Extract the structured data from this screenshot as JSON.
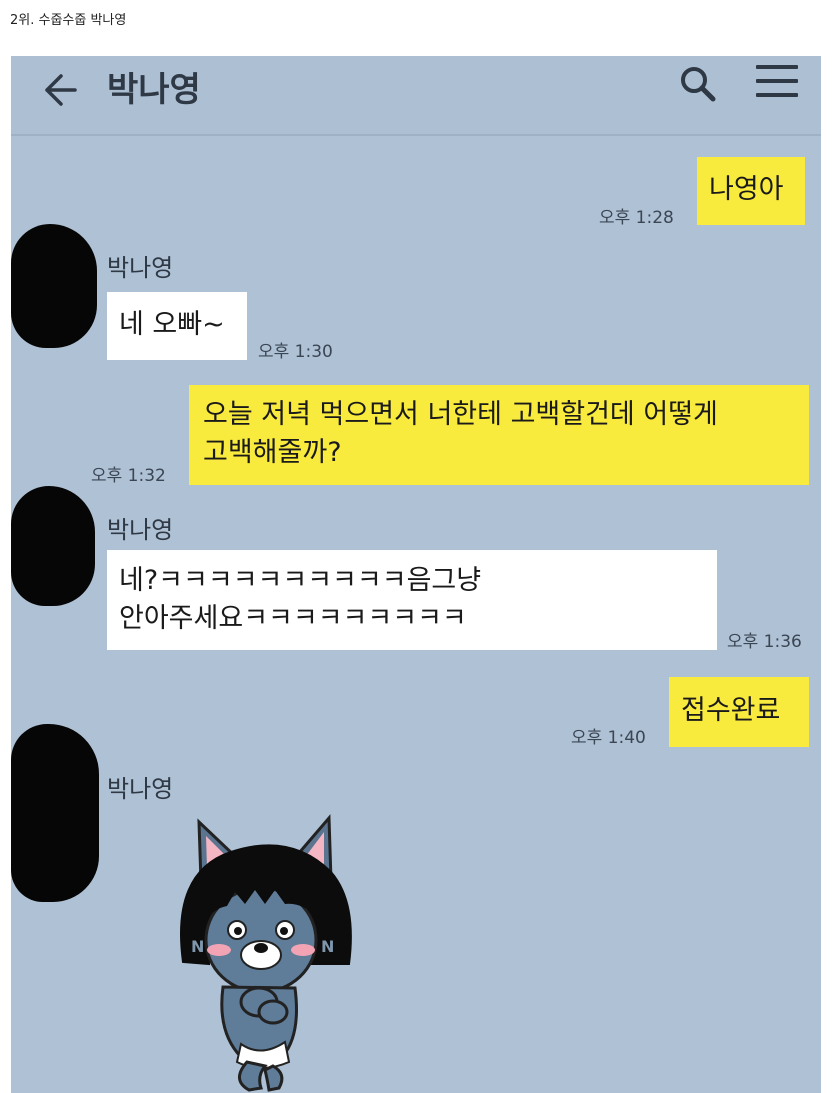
{
  "caption": "2위. 수줍수줍 박나영",
  "chat": {
    "title": "박나영",
    "icons": {
      "back": "back-arrow-icon",
      "search": "search-icon",
      "menu": "hamburger-menu-icon"
    },
    "messages": [
      {
        "from": "me",
        "text": "나영아",
        "time": "오후 1:28"
      },
      {
        "from": "them",
        "sender": "박나영",
        "text": "네 오빠~",
        "time": "오후 1:30"
      },
      {
        "from": "me",
        "lines": [
          "오늘 저녁 먹으면서 너한테 고백할건데 어떻게",
          "고백해줄까?"
        ],
        "time": "오후 1:32"
      },
      {
        "from": "them",
        "sender": "박나영",
        "lines": [
          "네?ㅋㅋㅋㅋㅋㅋㅋㅋㅋㅋ음그냥",
          "안아주세요ㅋㅋㅋㅋㅋㅋㅋㅋㅋ"
        ],
        "time": "오후 1:36"
      },
      {
        "from": "me",
        "text": "접수완료",
        "time": "오후 1:40"
      },
      {
        "from": "them",
        "sender": "박나영",
        "sticker": "kakao-neo-shy-sticker"
      }
    ]
  },
  "colors": {
    "chat_bg": "#afc1d4",
    "my_bubble": "#f9eb3d",
    "their_bubble": "#ffffff"
  }
}
